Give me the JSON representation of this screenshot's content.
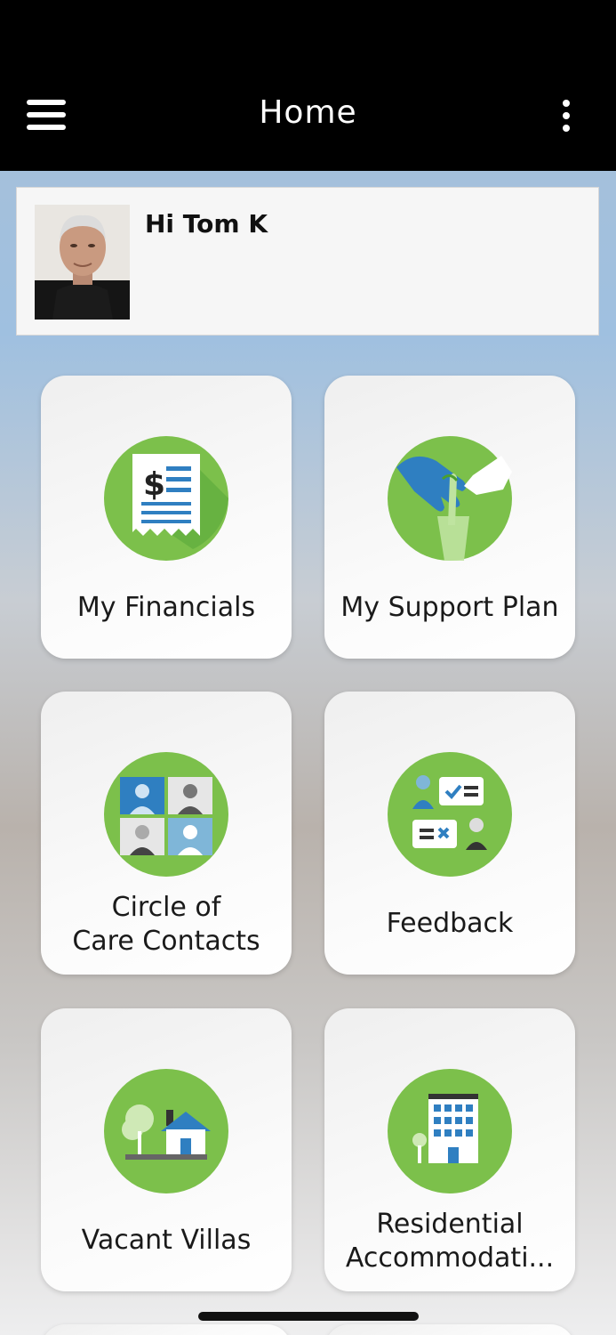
{
  "header": {
    "title": "Home",
    "menu_icon": "hamburger-menu-icon",
    "more_icon": "vertical-ellipsis-icon"
  },
  "profile": {
    "greeting": "Hi Tom K",
    "avatar": "user-photo"
  },
  "tiles": [
    {
      "label": "My Financials",
      "icon": "financial-receipt-icon"
    },
    {
      "label": "My Support Plan",
      "icon": "helping-hands-icon"
    },
    {
      "label": "Circle of\nCare Contacts",
      "icon": "contacts-grid-icon"
    },
    {
      "label": "Feedback",
      "icon": "feedback-chat-icon"
    },
    {
      "label": "Vacant Villas",
      "icon": "villa-house-icon"
    },
    {
      "label": "Residential\nAccommodati...",
      "icon": "apartment-building-icon"
    }
  ],
  "colors": {
    "accent_green": "#7cc04b",
    "dark_green": "#4a9e2f",
    "accent_blue": "#2f7fc1",
    "header_bg": "#000000"
  }
}
